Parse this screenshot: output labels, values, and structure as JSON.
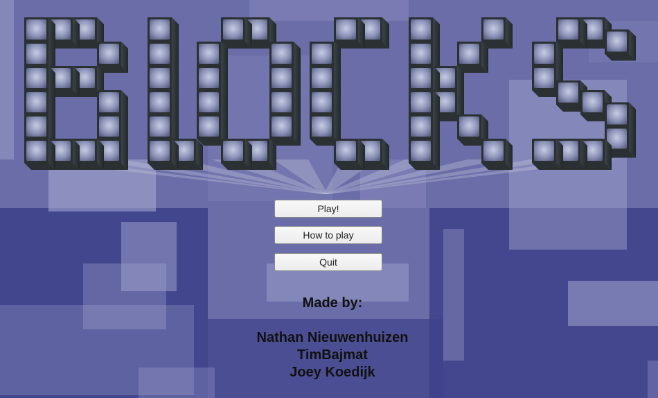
{
  "logo": {
    "word": "BLOCKS",
    "face_color": "#7c82a8",
    "side_color": "#2b3033"
  },
  "menu": {
    "play_label": "Play!",
    "how_to_play_label": "How to play",
    "quit_label": "Quit"
  },
  "credits": {
    "heading": "Made by:",
    "authors": [
      "Nathan Nieuwenhuizen",
      "TimBajmat",
      "Joey Koedijk"
    ]
  },
  "colors": {
    "background": "#5a5c9e",
    "background_dark": "#3e418a",
    "background_light": "#a3a6cf"
  }
}
